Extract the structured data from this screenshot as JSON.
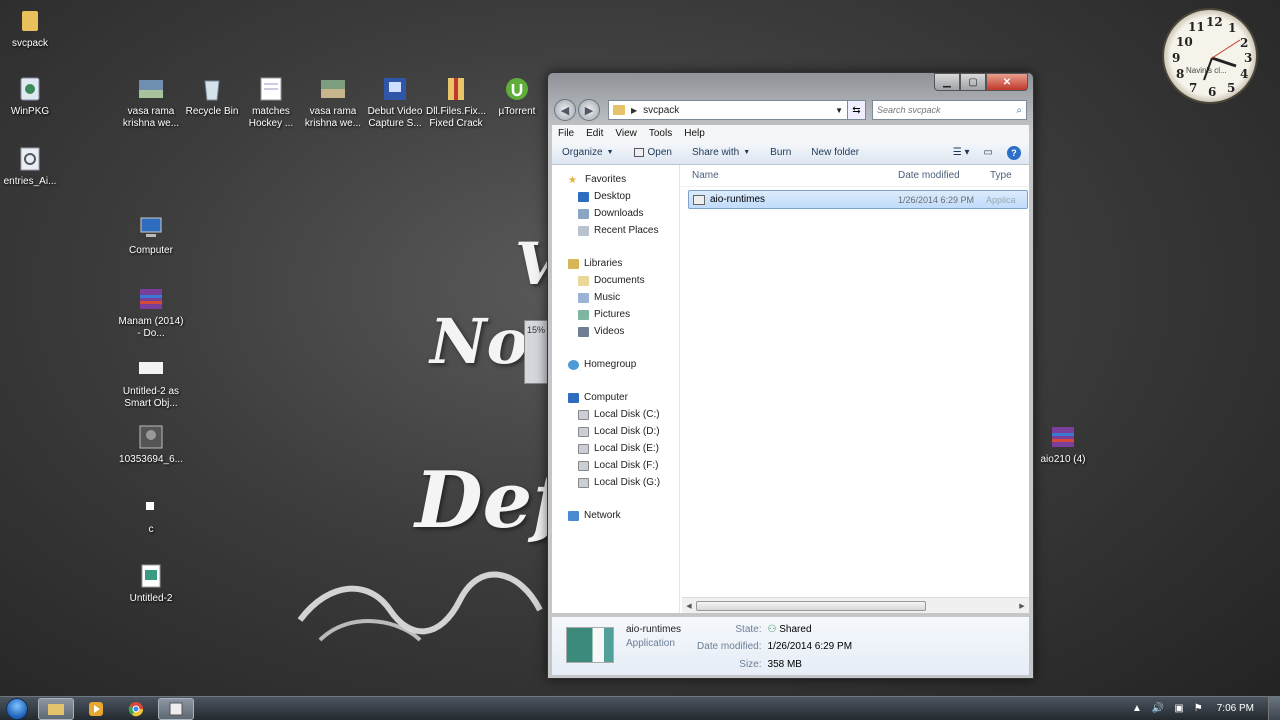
{
  "desktop": {
    "icons": [
      {
        "id": "svcpack",
        "label": "svcpack"
      },
      {
        "id": "winpkg",
        "label": "WinPKG"
      },
      {
        "id": "vasa1",
        "label": "vasa rama krishna we..."
      },
      {
        "id": "recycle",
        "label": "Recycle Bin"
      },
      {
        "id": "matches",
        "label": "matches Hockey ..."
      },
      {
        "id": "vasa2",
        "label": "vasa rama krishna we..."
      },
      {
        "id": "debut",
        "label": "Debut Video Capture S..."
      },
      {
        "id": "dllfiles",
        "label": "Dll.Files.Fix... Fixed Crack"
      },
      {
        "id": "utorrent",
        "label": "µTorrent"
      },
      {
        "id": "entries",
        "label": "entries_Ai..."
      },
      {
        "id": "computer",
        "label": "Computer"
      },
      {
        "id": "manam",
        "label": "Manam (2014) - Do..."
      },
      {
        "id": "untitled2as",
        "label": "Untitled-2 as Smart Obj..."
      },
      {
        "id": "img10353694",
        "label": "10353694_6..."
      },
      {
        "id": "c",
        "label": "c"
      },
      {
        "id": "untitled2",
        "label": "Untitled-2"
      },
      {
        "id": "aio210",
        "label": "aio210 (4)"
      }
    ],
    "wallpaper": {
      "line1": "Not",
      "line2": "Def",
      "line3": "V"
    }
  },
  "clock": {
    "numbers": [
      "12",
      "1",
      "2",
      "3",
      "4",
      "5",
      "6",
      "7",
      "8",
      "9",
      "10",
      "11"
    ],
    "label": "Navin's cl..."
  },
  "mini_window": {
    "text": "15%"
  },
  "explorer": {
    "address": {
      "crumb": "svcpack"
    },
    "search": {
      "placeholder": "Search svcpack"
    },
    "menu": [
      "File",
      "Edit",
      "View",
      "Tools",
      "Help"
    ],
    "toolbar": {
      "organize": "Organize",
      "open": "Open",
      "share": "Share with",
      "burn": "Burn",
      "new_folder": "New folder"
    },
    "nav": {
      "favorites": "Favorites",
      "fav_items": [
        "Desktop",
        "Downloads",
        "Recent Places"
      ],
      "libraries": "Libraries",
      "lib_items": [
        "Documents",
        "Music",
        "Pictures",
        "Videos"
      ],
      "homegroup": "Homegroup",
      "computer": "Computer",
      "drives": [
        "Local Disk (C:)",
        "Local Disk (D:)",
        "Local Disk (E:)",
        "Local Disk (F:)",
        "Local Disk (G:)"
      ],
      "network": "Network"
    },
    "columns": {
      "name": "Name",
      "date": "Date modified",
      "type": "Type"
    },
    "files": [
      {
        "name": "aio-runtimes",
        "date": "1/26/2014 6:29 PM",
        "type": "Applica"
      }
    ],
    "details": {
      "name": "aio-runtimes",
      "kind": "Application",
      "state_label": "State:",
      "state_value": "Shared",
      "date_label": "Date modified:",
      "date_value": "1/26/2014 6:29 PM",
      "size_label": "Size:",
      "size_value": "358 MB"
    }
  },
  "taskbar": {
    "time": "7:06 PM"
  },
  "colors": {
    "accent": "#2d6ec9",
    "selection": "#c1dcfc"
  }
}
